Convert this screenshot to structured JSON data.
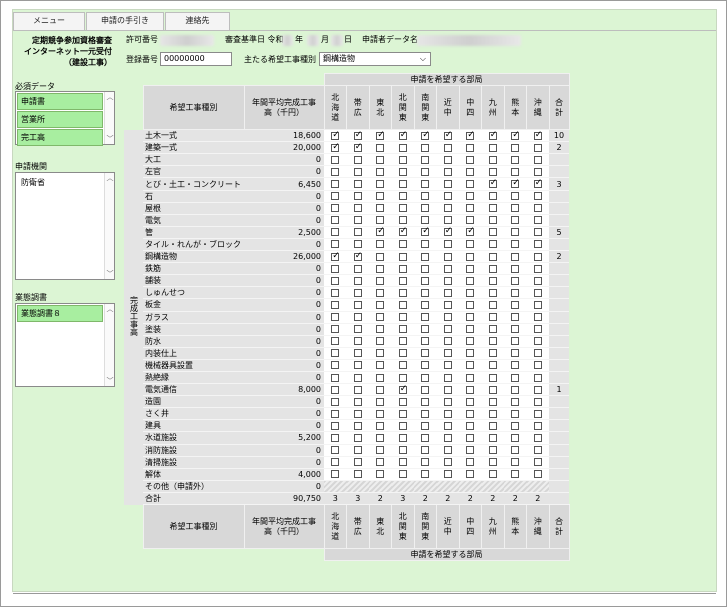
{
  "tabs": [
    "メニュー",
    "申請の手引き",
    "連絡先"
  ],
  "header": {
    "title_line1": "定期競争参加資格審査",
    "title_line2": "インターネット一元受付",
    "title_line3": "（建設工事）",
    "permit_label": "許可番号",
    "base_date_label": "審査基準日 令和",
    "year_label": "年",
    "month_label": "月",
    "day_label": "日",
    "app_data_name_label": "申請者データ名",
    "reg_number_label": "登録番号",
    "reg_number_value": "00000000",
    "main_type_label": "主たる希望工事種別",
    "main_type_value": "鋼構造物"
  },
  "sidebar": {
    "required_label": "必須データ",
    "required_items": [
      "申請書",
      "営業所",
      "完工高"
    ],
    "org_label": "申請機関",
    "org_items": [
      "防衛省"
    ],
    "survey_label": "業態調書",
    "survey_items": [
      "業態調書８"
    ]
  },
  "table": {
    "dept_header": "申請を希望する部局",
    "col_type": "希望工事種別",
    "col_avg": "年間平均完成工事高（千円）",
    "col_total": "合計",
    "side_label": "完成工事高",
    "regions": [
      "北海道",
      "帯広",
      "東北",
      "北関東",
      "南関東",
      "近中",
      "中四",
      "九州",
      "熊本",
      "沖縄"
    ],
    "rows": [
      {
        "name": "土木一式",
        "amount": "18,600",
        "checks": [
          1,
          1,
          1,
          1,
          1,
          1,
          1,
          1,
          1,
          1
        ],
        "total": "10"
      },
      {
        "name": "建築一式",
        "amount": "20,000",
        "checks": [
          1,
          1,
          0,
          0,
          0,
          0,
          0,
          0,
          0,
          0
        ],
        "total": "2"
      },
      {
        "name": "大工",
        "amount": "0",
        "checks": [
          0,
          0,
          0,
          0,
          0,
          0,
          0,
          0,
          0,
          0
        ],
        "total": ""
      },
      {
        "name": "左官",
        "amount": "0",
        "checks": [
          0,
          0,
          0,
          0,
          0,
          0,
          0,
          0,
          0,
          0
        ],
        "total": ""
      },
      {
        "name": "とび・土工・コンクリート",
        "amount": "6,450",
        "checks": [
          0,
          0,
          0,
          0,
          0,
          0,
          0,
          1,
          1,
          1
        ],
        "total": "3"
      },
      {
        "name": "石",
        "amount": "0",
        "checks": [
          0,
          0,
          0,
          0,
          0,
          0,
          0,
          0,
          0,
          0
        ],
        "total": ""
      },
      {
        "name": "屋根",
        "amount": "0",
        "checks": [
          0,
          0,
          0,
          0,
          0,
          0,
          0,
          0,
          0,
          0
        ],
        "total": ""
      },
      {
        "name": "電気",
        "amount": "0",
        "checks": [
          0,
          0,
          0,
          0,
          0,
          0,
          0,
          0,
          0,
          0
        ],
        "total": ""
      },
      {
        "name": "管",
        "amount": "2,500",
        "checks": [
          0,
          0,
          1,
          1,
          1,
          1,
          1,
          0,
          0,
          0
        ],
        "total": "5"
      },
      {
        "name": "タイル・れんが・ブロック",
        "amount": "0",
        "checks": [
          0,
          0,
          0,
          0,
          0,
          0,
          0,
          0,
          0,
          0
        ],
        "total": ""
      },
      {
        "name": "鋼構造物",
        "amount": "26,000",
        "checks": [
          1,
          1,
          0,
          0,
          0,
          0,
          0,
          0,
          0,
          0
        ],
        "total": "2"
      },
      {
        "name": "鉄筋",
        "amount": "0",
        "checks": [
          0,
          0,
          0,
          0,
          0,
          0,
          0,
          0,
          0,
          0
        ],
        "total": ""
      },
      {
        "name": "舗装",
        "amount": "0",
        "checks": [
          0,
          0,
          0,
          0,
          0,
          0,
          0,
          0,
          0,
          0
        ],
        "total": ""
      },
      {
        "name": "しゅんせつ",
        "amount": "0",
        "checks": [
          0,
          0,
          0,
          0,
          0,
          0,
          0,
          0,
          0,
          0
        ],
        "total": ""
      },
      {
        "name": "板金",
        "amount": "0",
        "checks": [
          0,
          0,
          0,
          0,
          0,
          0,
          0,
          0,
          0,
          0
        ],
        "total": ""
      },
      {
        "name": "ガラス",
        "amount": "0",
        "checks": [
          0,
          0,
          0,
          0,
          0,
          0,
          0,
          0,
          0,
          0
        ],
        "total": ""
      },
      {
        "name": "塗装",
        "amount": "0",
        "checks": [
          0,
          0,
          0,
          0,
          0,
          0,
          0,
          0,
          0,
          0
        ],
        "total": ""
      },
      {
        "name": "防水",
        "amount": "0",
        "checks": [
          0,
          0,
          0,
          0,
          0,
          0,
          0,
          0,
          0,
          0
        ],
        "total": ""
      },
      {
        "name": "内装仕上",
        "amount": "0",
        "checks": [
          0,
          0,
          0,
          0,
          0,
          0,
          0,
          0,
          0,
          0
        ],
        "total": ""
      },
      {
        "name": "機械器具設置",
        "amount": "0",
        "checks": [
          0,
          0,
          0,
          0,
          0,
          0,
          0,
          0,
          0,
          0
        ],
        "total": ""
      },
      {
        "name": "熱絶縁",
        "amount": "0",
        "checks": [
          0,
          0,
          0,
          0,
          0,
          0,
          0,
          0,
          0,
          0
        ],
        "total": ""
      },
      {
        "name": "電気通信",
        "amount": "8,000",
        "checks": [
          0,
          0,
          0,
          1,
          0,
          0,
          0,
          0,
          0,
          0
        ],
        "total": "1"
      },
      {
        "name": "造園",
        "amount": "0",
        "checks": [
          0,
          0,
          0,
          0,
          0,
          0,
          0,
          0,
          0,
          0
        ],
        "total": ""
      },
      {
        "name": "さく井",
        "amount": "0",
        "checks": [
          0,
          0,
          0,
          0,
          0,
          0,
          0,
          0,
          0,
          0
        ],
        "total": ""
      },
      {
        "name": "建具",
        "amount": "0",
        "checks": [
          0,
          0,
          0,
          0,
          0,
          0,
          0,
          0,
          0,
          0
        ],
        "total": ""
      },
      {
        "name": "水道施設",
        "amount": "5,200",
        "checks": [
          0,
          0,
          0,
          0,
          0,
          0,
          0,
          0,
          0,
          0
        ],
        "total": ""
      },
      {
        "name": "消防施設",
        "amount": "0",
        "checks": [
          0,
          0,
          0,
          0,
          0,
          0,
          0,
          0,
          0,
          0
        ],
        "total": ""
      },
      {
        "name": "清掃施設",
        "amount": "0",
        "checks": [
          0,
          0,
          0,
          0,
          0,
          0,
          0,
          0,
          0,
          0
        ],
        "total": ""
      },
      {
        "name": "解体",
        "amount": "4,000",
        "checks": [
          0,
          0,
          0,
          0,
          0,
          0,
          0,
          0,
          0,
          0
        ],
        "total": ""
      },
      {
        "name": "その他（申請外）",
        "amount": "0",
        "checks": null,
        "total": ""
      }
    ],
    "sum_row": {
      "name": "合計",
      "amount": "90,750",
      "region_totals": [
        "3",
        "3",
        "2",
        "3",
        "2",
        "2",
        "2",
        "2",
        "2",
        "2"
      ]
    }
  }
}
